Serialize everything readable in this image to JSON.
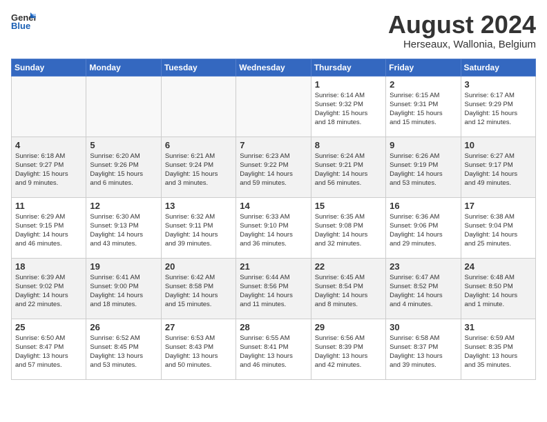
{
  "header": {
    "logo_line1": "General",
    "logo_line2": "Blue",
    "month": "August 2024",
    "location": "Herseaux, Wallonia, Belgium"
  },
  "days_of_week": [
    "Sunday",
    "Monday",
    "Tuesday",
    "Wednesday",
    "Thursday",
    "Friday",
    "Saturday"
  ],
  "weeks": [
    [
      {
        "day": "",
        "info": "",
        "empty": true
      },
      {
        "day": "",
        "info": "",
        "empty": true
      },
      {
        "day": "",
        "info": "",
        "empty": true
      },
      {
        "day": "",
        "info": "",
        "empty": true
      },
      {
        "day": "1",
        "info": "Sunrise: 6:14 AM\nSunset: 9:32 PM\nDaylight: 15 hours\nand 18 minutes.",
        "empty": false
      },
      {
        "day": "2",
        "info": "Sunrise: 6:15 AM\nSunset: 9:31 PM\nDaylight: 15 hours\nand 15 minutes.",
        "empty": false
      },
      {
        "day": "3",
        "info": "Sunrise: 6:17 AM\nSunset: 9:29 PM\nDaylight: 15 hours\nand 12 minutes.",
        "empty": false
      }
    ],
    [
      {
        "day": "4",
        "info": "Sunrise: 6:18 AM\nSunset: 9:27 PM\nDaylight: 15 hours\nand 9 minutes.",
        "empty": false
      },
      {
        "day": "5",
        "info": "Sunrise: 6:20 AM\nSunset: 9:26 PM\nDaylight: 15 hours\nand 6 minutes.",
        "empty": false
      },
      {
        "day": "6",
        "info": "Sunrise: 6:21 AM\nSunset: 9:24 PM\nDaylight: 15 hours\nand 3 minutes.",
        "empty": false
      },
      {
        "day": "7",
        "info": "Sunrise: 6:23 AM\nSunset: 9:22 PM\nDaylight: 14 hours\nand 59 minutes.",
        "empty": false
      },
      {
        "day": "8",
        "info": "Sunrise: 6:24 AM\nSunset: 9:21 PM\nDaylight: 14 hours\nand 56 minutes.",
        "empty": false
      },
      {
        "day": "9",
        "info": "Sunrise: 6:26 AM\nSunset: 9:19 PM\nDaylight: 14 hours\nand 53 minutes.",
        "empty": false
      },
      {
        "day": "10",
        "info": "Sunrise: 6:27 AM\nSunset: 9:17 PM\nDaylight: 14 hours\nand 49 minutes.",
        "empty": false
      }
    ],
    [
      {
        "day": "11",
        "info": "Sunrise: 6:29 AM\nSunset: 9:15 PM\nDaylight: 14 hours\nand 46 minutes.",
        "empty": false
      },
      {
        "day": "12",
        "info": "Sunrise: 6:30 AM\nSunset: 9:13 PM\nDaylight: 14 hours\nand 43 minutes.",
        "empty": false
      },
      {
        "day": "13",
        "info": "Sunrise: 6:32 AM\nSunset: 9:11 PM\nDaylight: 14 hours\nand 39 minutes.",
        "empty": false
      },
      {
        "day": "14",
        "info": "Sunrise: 6:33 AM\nSunset: 9:10 PM\nDaylight: 14 hours\nand 36 minutes.",
        "empty": false
      },
      {
        "day": "15",
        "info": "Sunrise: 6:35 AM\nSunset: 9:08 PM\nDaylight: 14 hours\nand 32 minutes.",
        "empty": false
      },
      {
        "day": "16",
        "info": "Sunrise: 6:36 AM\nSunset: 9:06 PM\nDaylight: 14 hours\nand 29 minutes.",
        "empty": false
      },
      {
        "day": "17",
        "info": "Sunrise: 6:38 AM\nSunset: 9:04 PM\nDaylight: 14 hours\nand 25 minutes.",
        "empty": false
      }
    ],
    [
      {
        "day": "18",
        "info": "Sunrise: 6:39 AM\nSunset: 9:02 PM\nDaylight: 14 hours\nand 22 minutes.",
        "empty": false
      },
      {
        "day": "19",
        "info": "Sunrise: 6:41 AM\nSunset: 9:00 PM\nDaylight: 14 hours\nand 18 minutes.",
        "empty": false
      },
      {
        "day": "20",
        "info": "Sunrise: 6:42 AM\nSunset: 8:58 PM\nDaylight: 14 hours\nand 15 minutes.",
        "empty": false
      },
      {
        "day": "21",
        "info": "Sunrise: 6:44 AM\nSunset: 8:56 PM\nDaylight: 14 hours\nand 11 minutes.",
        "empty": false
      },
      {
        "day": "22",
        "info": "Sunrise: 6:45 AM\nSunset: 8:54 PM\nDaylight: 14 hours\nand 8 minutes.",
        "empty": false
      },
      {
        "day": "23",
        "info": "Sunrise: 6:47 AM\nSunset: 8:52 PM\nDaylight: 14 hours\nand 4 minutes.",
        "empty": false
      },
      {
        "day": "24",
        "info": "Sunrise: 6:48 AM\nSunset: 8:50 PM\nDaylight: 14 hours\nand 1 minute.",
        "empty": false
      }
    ],
    [
      {
        "day": "25",
        "info": "Sunrise: 6:50 AM\nSunset: 8:47 PM\nDaylight: 13 hours\nand 57 minutes.",
        "empty": false
      },
      {
        "day": "26",
        "info": "Sunrise: 6:52 AM\nSunset: 8:45 PM\nDaylight: 13 hours\nand 53 minutes.",
        "empty": false
      },
      {
        "day": "27",
        "info": "Sunrise: 6:53 AM\nSunset: 8:43 PM\nDaylight: 13 hours\nand 50 minutes.",
        "empty": false
      },
      {
        "day": "28",
        "info": "Sunrise: 6:55 AM\nSunset: 8:41 PM\nDaylight: 13 hours\nand 46 minutes.",
        "empty": false
      },
      {
        "day": "29",
        "info": "Sunrise: 6:56 AM\nSunset: 8:39 PM\nDaylight: 13 hours\nand 42 minutes.",
        "empty": false
      },
      {
        "day": "30",
        "info": "Sunrise: 6:58 AM\nSunset: 8:37 PM\nDaylight: 13 hours\nand 39 minutes.",
        "empty": false
      },
      {
        "day": "31",
        "info": "Sunrise: 6:59 AM\nSunset: 8:35 PM\nDaylight: 13 hours\nand 35 minutes.",
        "empty": false
      }
    ]
  ]
}
